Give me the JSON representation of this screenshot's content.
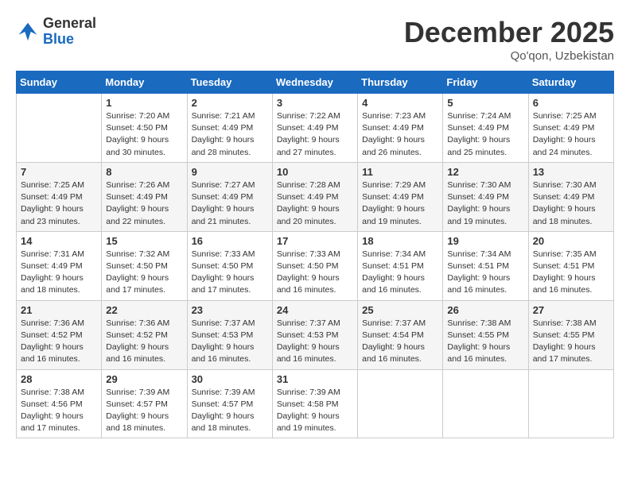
{
  "logo": {
    "general": "General",
    "blue": "Blue"
  },
  "title": "December 2025",
  "location": "Qo'qon, Uzbekistan",
  "days_of_week": [
    "Sunday",
    "Monday",
    "Tuesday",
    "Wednesday",
    "Thursday",
    "Friday",
    "Saturday"
  ],
  "weeks": [
    [
      {
        "day": "",
        "sunrise": "",
        "sunset": "",
        "daylight": ""
      },
      {
        "day": "1",
        "sunrise": "Sunrise: 7:20 AM",
        "sunset": "Sunset: 4:50 PM",
        "daylight": "Daylight: 9 hours and 30 minutes."
      },
      {
        "day": "2",
        "sunrise": "Sunrise: 7:21 AM",
        "sunset": "Sunset: 4:49 PM",
        "daylight": "Daylight: 9 hours and 28 minutes."
      },
      {
        "day": "3",
        "sunrise": "Sunrise: 7:22 AM",
        "sunset": "Sunset: 4:49 PM",
        "daylight": "Daylight: 9 hours and 27 minutes."
      },
      {
        "day": "4",
        "sunrise": "Sunrise: 7:23 AM",
        "sunset": "Sunset: 4:49 PM",
        "daylight": "Daylight: 9 hours and 26 minutes."
      },
      {
        "day": "5",
        "sunrise": "Sunrise: 7:24 AM",
        "sunset": "Sunset: 4:49 PM",
        "daylight": "Daylight: 9 hours and 25 minutes."
      },
      {
        "day": "6",
        "sunrise": "Sunrise: 7:25 AM",
        "sunset": "Sunset: 4:49 PM",
        "daylight": "Daylight: 9 hours and 24 minutes."
      }
    ],
    [
      {
        "day": "7",
        "sunrise": "Sunrise: 7:25 AM",
        "sunset": "Sunset: 4:49 PM",
        "daylight": "Daylight: 9 hours and 23 minutes."
      },
      {
        "day": "8",
        "sunrise": "Sunrise: 7:26 AM",
        "sunset": "Sunset: 4:49 PM",
        "daylight": "Daylight: 9 hours and 22 minutes."
      },
      {
        "day": "9",
        "sunrise": "Sunrise: 7:27 AM",
        "sunset": "Sunset: 4:49 PM",
        "daylight": "Daylight: 9 hours and 21 minutes."
      },
      {
        "day": "10",
        "sunrise": "Sunrise: 7:28 AM",
        "sunset": "Sunset: 4:49 PM",
        "daylight": "Daylight: 9 hours and 20 minutes."
      },
      {
        "day": "11",
        "sunrise": "Sunrise: 7:29 AM",
        "sunset": "Sunset: 4:49 PM",
        "daylight": "Daylight: 9 hours and 19 minutes."
      },
      {
        "day": "12",
        "sunrise": "Sunrise: 7:30 AM",
        "sunset": "Sunset: 4:49 PM",
        "daylight": "Daylight: 9 hours and 19 minutes."
      },
      {
        "day": "13",
        "sunrise": "Sunrise: 7:30 AM",
        "sunset": "Sunset: 4:49 PM",
        "daylight": "Daylight: 9 hours and 18 minutes."
      }
    ],
    [
      {
        "day": "14",
        "sunrise": "Sunrise: 7:31 AM",
        "sunset": "Sunset: 4:49 PM",
        "daylight": "Daylight: 9 hours and 18 minutes."
      },
      {
        "day": "15",
        "sunrise": "Sunrise: 7:32 AM",
        "sunset": "Sunset: 4:50 PM",
        "daylight": "Daylight: 9 hours and 17 minutes."
      },
      {
        "day": "16",
        "sunrise": "Sunrise: 7:33 AM",
        "sunset": "Sunset: 4:50 PM",
        "daylight": "Daylight: 9 hours and 17 minutes."
      },
      {
        "day": "17",
        "sunrise": "Sunrise: 7:33 AM",
        "sunset": "Sunset: 4:50 PM",
        "daylight": "Daylight: 9 hours and 16 minutes."
      },
      {
        "day": "18",
        "sunrise": "Sunrise: 7:34 AM",
        "sunset": "Sunset: 4:51 PM",
        "daylight": "Daylight: 9 hours and 16 minutes."
      },
      {
        "day": "19",
        "sunrise": "Sunrise: 7:34 AM",
        "sunset": "Sunset: 4:51 PM",
        "daylight": "Daylight: 9 hours and 16 minutes."
      },
      {
        "day": "20",
        "sunrise": "Sunrise: 7:35 AM",
        "sunset": "Sunset: 4:51 PM",
        "daylight": "Daylight: 9 hours and 16 minutes."
      }
    ],
    [
      {
        "day": "21",
        "sunrise": "Sunrise: 7:36 AM",
        "sunset": "Sunset: 4:52 PM",
        "daylight": "Daylight: 9 hours and 16 minutes."
      },
      {
        "day": "22",
        "sunrise": "Sunrise: 7:36 AM",
        "sunset": "Sunset: 4:52 PM",
        "daylight": "Daylight: 9 hours and 16 minutes."
      },
      {
        "day": "23",
        "sunrise": "Sunrise: 7:37 AM",
        "sunset": "Sunset: 4:53 PM",
        "daylight": "Daylight: 9 hours and 16 minutes."
      },
      {
        "day": "24",
        "sunrise": "Sunrise: 7:37 AM",
        "sunset": "Sunset: 4:53 PM",
        "daylight": "Daylight: 9 hours and 16 minutes."
      },
      {
        "day": "25",
        "sunrise": "Sunrise: 7:37 AM",
        "sunset": "Sunset: 4:54 PM",
        "daylight": "Daylight: 9 hours and 16 minutes."
      },
      {
        "day": "26",
        "sunrise": "Sunrise: 7:38 AM",
        "sunset": "Sunset: 4:55 PM",
        "daylight": "Daylight: 9 hours and 16 minutes."
      },
      {
        "day": "27",
        "sunrise": "Sunrise: 7:38 AM",
        "sunset": "Sunset: 4:55 PM",
        "daylight": "Daylight: 9 hours and 17 minutes."
      }
    ],
    [
      {
        "day": "28",
        "sunrise": "Sunrise: 7:38 AM",
        "sunset": "Sunset: 4:56 PM",
        "daylight": "Daylight: 9 hours and 17 minutes."
      },
      {
        "day": "29",
        "sunrise": "Sunrise: 7:39 AM",
        "sunset": "Sunset: 4:57 PM",
        "daylight": "Daylight: 9 hours and 18 minutes."
      },
      {
        "day": "30",
        "sunrise": "Sunrise: 7:39 AM",
        "sunset": "Sunset: 4:57 PM",
        "daylight": "Daylight: 9 hours and 18 minutes."
      },
      {
        "day": "31",
        "sunrise": "Sunrise: 7:39 AM",
        "sunset": "Sunset: 4:58 PM",
        "daylight": "Daylight: 9 hours and 19 minutes."
      },
      {
        "day": "",
        "sunrise": "",
        "sunset": "",
        "daylight": ""
      },
      {
        "day": "",
        "sunrise": "",
        "sunset": "",
        "daylight": ""
      },
      {
        "day": "",
        "sunrise": "",
        "sunset": "",
        "daylight": ""
      }
    ]
  ]
}
